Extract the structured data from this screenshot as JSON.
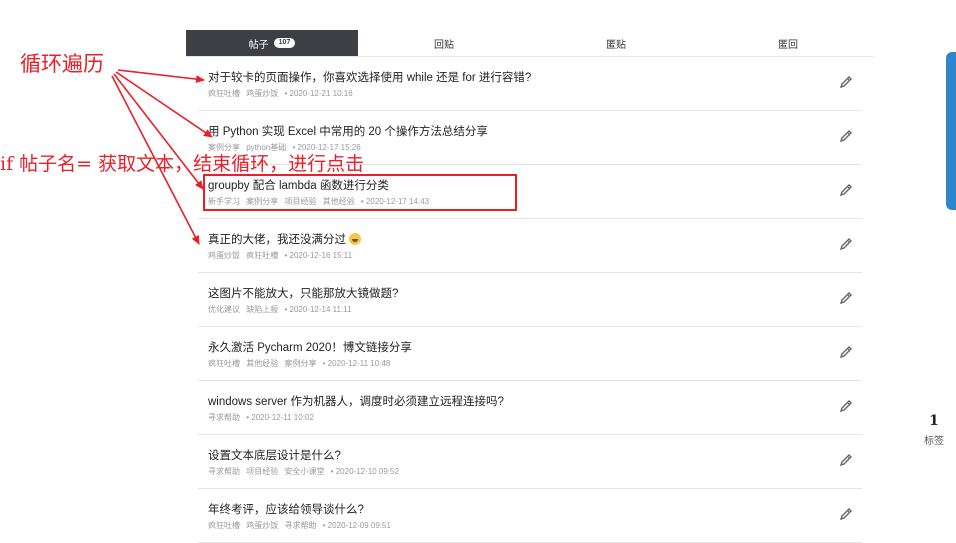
{
  "tabs": [
    {
      "label": "帖子",
      "badge": "107",
      "active": true
    },
    {
      "label": "回贴"
    },
    {
      "label": "匿贴"
    },
    {
      "label": "匿回"
    }
  ],
  "posts": [
    {
      "title": "对于较卡的页面操作，你喜欢选择使用 while 还是 for 进行容错?",
      "tags": [
        "疯狂吐槽",
        "鸡蛋炒饭"
      ],
      "date": "• 2020-12-21 10:16"
    },
    {
      "title": "用 Python 实现 Excel 中常用的 20 个操作方法总结分享",
      "tags": [
        "案例分享",
        "python基础"
      ],
      "date": "• 2020-12-17 15:26"
    },
    {
      "title": "groupby 配合 lambda 函数进行分类",
      "tags": [
        "新手学习",
        "案例分享",
        "项目经验",
        "其他经验"
      ],
      "date": "• 2020-12-17 14:43"
    },
    {
      "title": "真正的大佬，我还没满分过",
      "emoji": true,
      "tags": [
        "鸡蛋炒饭",
        "疯狂吐槽"
      ],
      "date": "• 2020-12-16 15:11"
    },
    {
      "title": "这图片不能放大，只能那放大镜做题?",
      "tags": [
        "优化建议",
        "缺陷上报"
      ],
      "date": "• 2020-12-14 11:11"
    },
    {
      "title": "永久激活 Pycharm 2020！博文链接分享",
      "tags": [
        "疯狂吐槽",
        "其他经验",
        "案例分享"
      ],
      "date": "• 2020-12-11 10:48"
    },
    {
      "title": "windows server 作为机器人，调度时必须建立远程连接吗?",
      "tags": [
        "寻求帮助"
      ],
      "date": "• 2020-12-11 10:02"
    },
    {
      "title": "设置文本底层设计是什么?",
      "tags": [
        "寻求帮助",
        "项目经验",
        "安全小课堂"
      ],
      "date": "• 2020-12-10 09:52"
    },
    {
      "title": "年终考评，应该给领导谈什么?",
      "tags": [
        "疯狂吐槽",
        "鸡蛋炒饭",
        "寻求帮助"
      ],
      "date": "• 2020-12-09 09:51"
    }
  ],
  "annotations": {
    "loop": "循环遍历",
    "condition": "if 帖子名= 获取文本，结束循环，进行点击",
    "color": "#e8202a"
  },
  "stats": {
    "count": "1",
    "label": "标签"
  },
  "icons": {
    "edit": "pencil-icon"
  },
  "colors": {
    "tab_active": "#3d3f44",
    "accent": "#2f85c9"
  }
}
